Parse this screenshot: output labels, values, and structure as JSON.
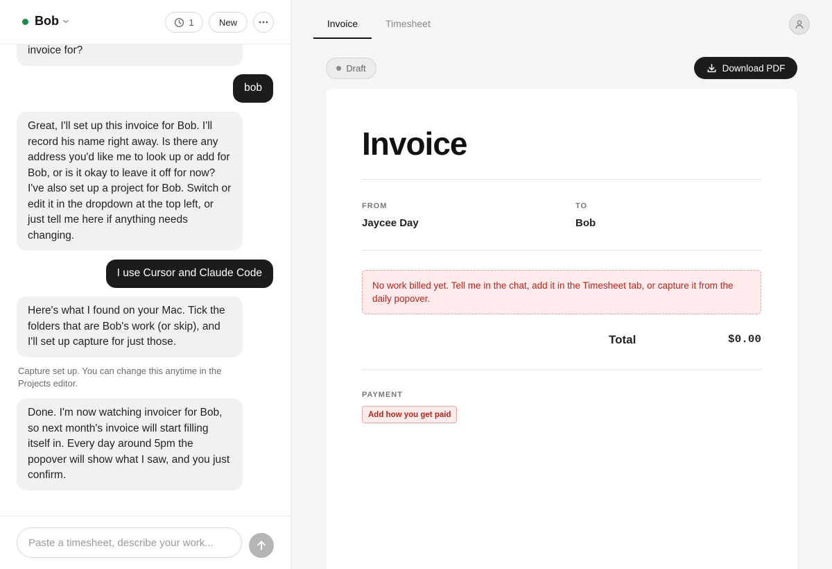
{
  "header": {
    "project_name": "Bob",
    "history_count": "1",
    "new_label": "New"
  },
  "chat": {
    "messages": [
      {
        "role": "assistant",
        "text": "invoice for?"
      },
      {
        "role": "user",
        "text": "bob"
      },
      {
        "role": "assistant",
        "text": "Great, I'll set up this invoice for Bob. I'll record his name right away. Is there any address you'd like me to look up or add for Bob, or is it okay to leave it off for now? I've also set up a project for Bob. Switch or edit it in the dropdown at the top left, or just tell me here if anything needs changing."
      },
      {
        "role": "user",
        "text": "I use Cursor and Claude Code"
      },
      {
        "role": "assistant",
        "text": "Here's what I found on your Mac. Tick the folders that are Bob's work (or skip), and I'll set up capture for just those."
      },
      {
        "role": "system",
        "text": "Capture set up. You can change this anytime in the Projects editor."
      },
      {
        "role": "assistant",
        "text": "Done. I'm now watching invoicer for Bob, so next month's invoice will start filling itself in. Every day around 5pm the popover will show what I saw, and you just confirm."
      }
    ],
    "composer_placeholder": "Paste a timesheet, describe your work..."
  },
  "tabs": {
    "invoice": "Invoice",
    "timesheet": "Timesheet"
  },
  "toolbar": {
    "status": "Draft",
    "download_label": "Download PDF"
  },
  "invoice": {
    "title": "Invoice",
    "from_label": "FROM",
    "from_name": "Jaycee Day",
    "to_label": "TO",
    "to_name": "Bob",
    "empty_notice": "No work billed yet. Tell me in the chat, add it in the Timesheet tab, or capture it from the daily popover.",
    "total_label": "Total",
    "total_value": "$0.00",
    "payment_label": "PAYMENT",
    "payment_button": "Add how you get paid"
  },
  "colors": {
    "status_online": "#1f8a4c",
    "user_bubble": "#1c1c1e",
    "assistant_bubble": "#f1f1f2",
    "alert_text": "#b3261e",
    "alert_bg": "#fdeaea"
  },
  "icons": {
    "status": "status-dot",
    "dropdown": "chevron-down-icon",
    "history": "clock-icon",
    "more": "more-horizontal-icon",
    "send": "arrow-up-icon",
    "download": "download-icon",
    "avatar": "user-icon"
  }
}
